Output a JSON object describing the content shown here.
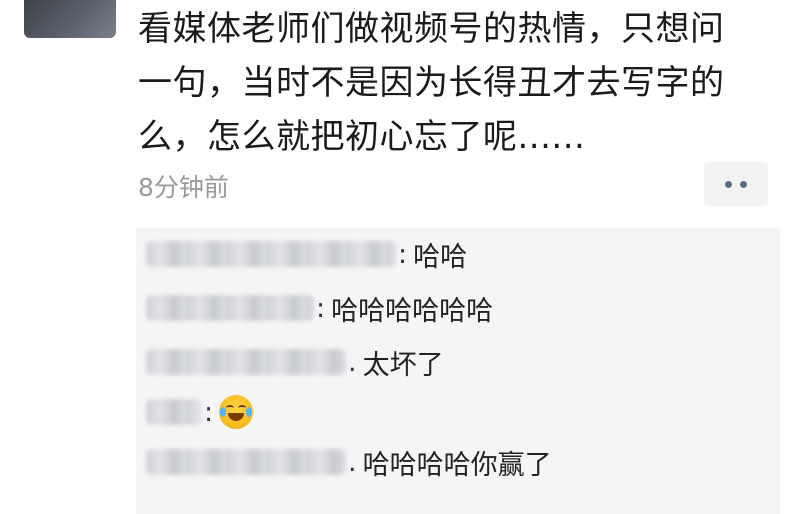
{
  "post": {
    "lines": [
      "看媒体老师们做视频号的热情，只想问",
      "一句，当时不是因为长得丑才去写字的",
      "么，怎么就把初心忘了呢......"
    ],
    "time": "8分钟前"
  },
  "comments": [
    {
      "sep": ":",
      "text": "哈哈"
    },
    {
      "sep": ":",
      "text": "哈哈哈哈哈哈"
    },
    {
      "sep": ".",
      "text": "太坏了"
    },
    {
      "sep": ":",
      "text": "",
      "emoji": "laughing-crying-emoji"
    },
    {
      "sep": ".",
      "text": "哈哈哈哈你赢了"
    }
  ],
  "colors": {
    "text": "#1b1b1b",
    "time": "#9a9a9a",
    "comment_bg": "#f5f5f5",
    "more_dots": "#5a6a8a"
  },
  "icons": [
    "avatar",
    "more-icon",
    "laughing-crying-emoji"
  ]
}
